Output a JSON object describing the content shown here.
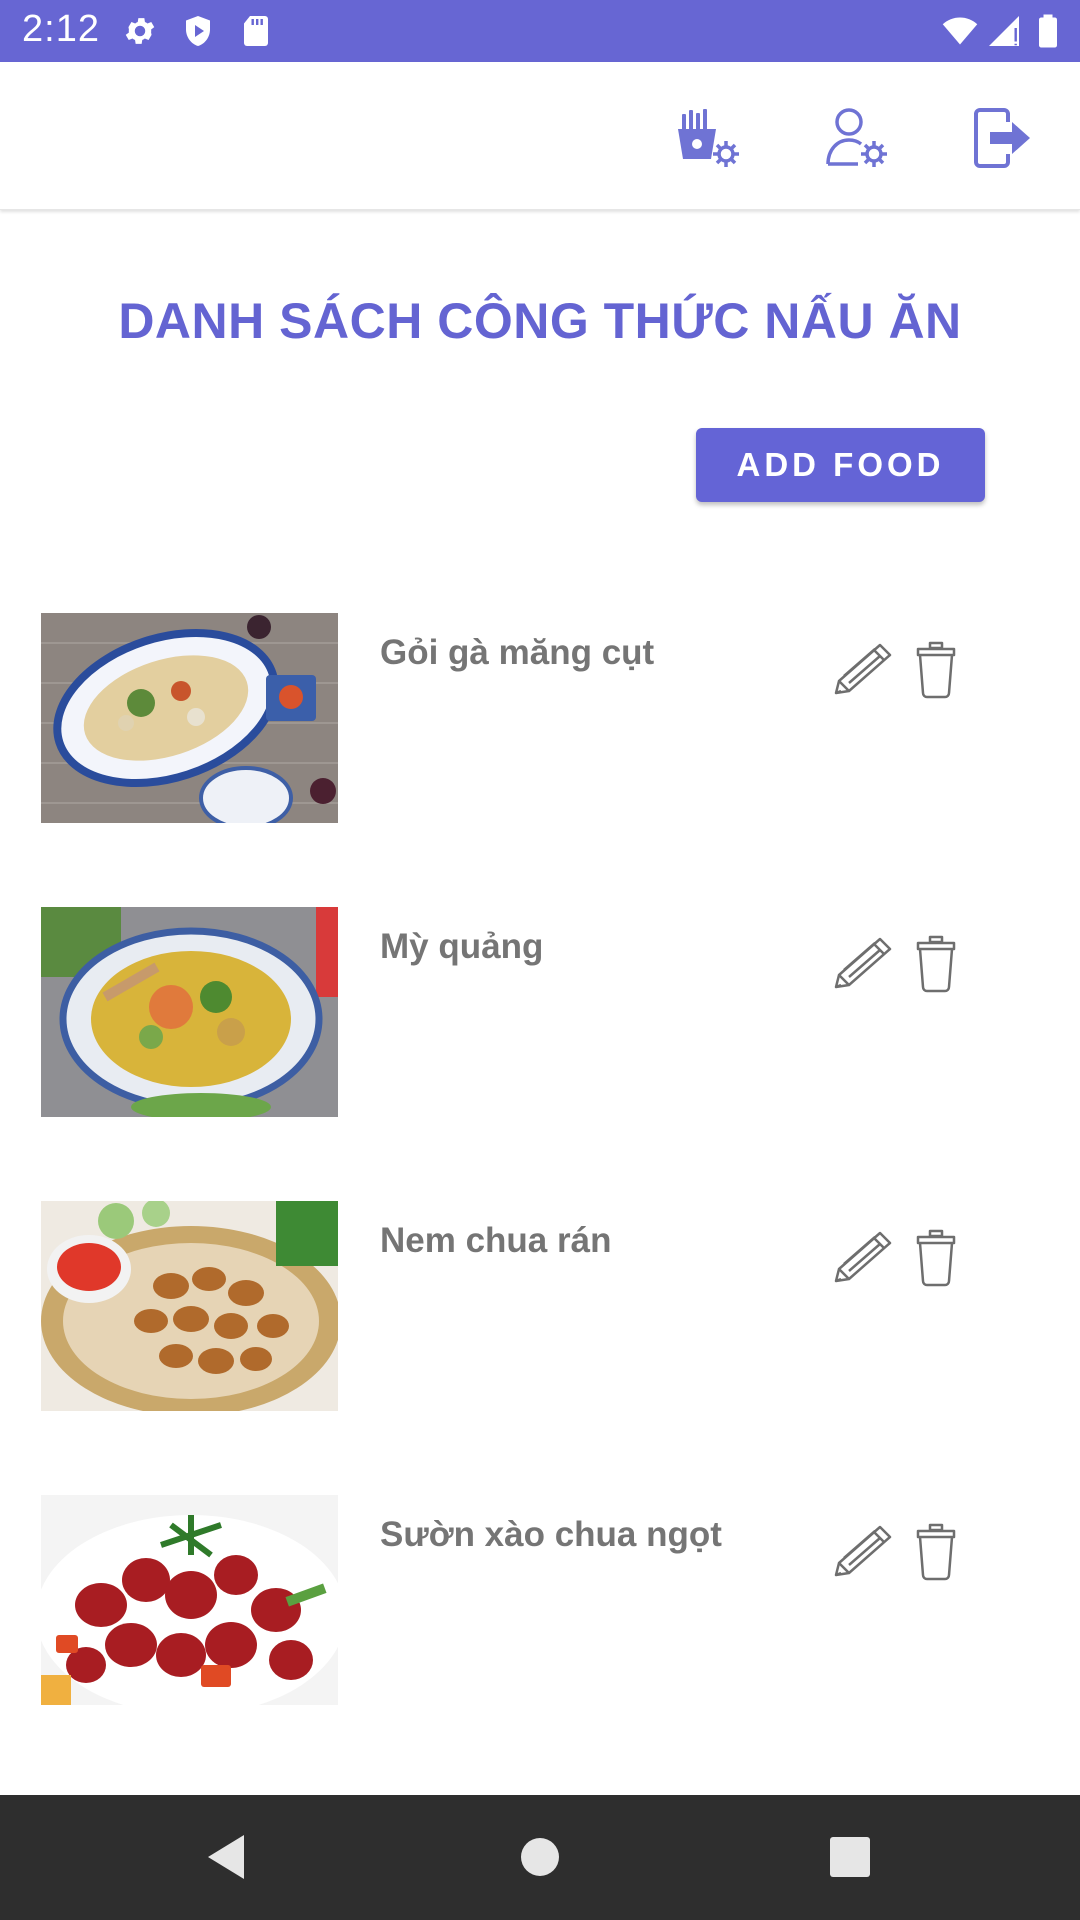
{
  "status_bar": {
    "time": "2:12",
    "left_icons": [
      "gear-icon",
      "play-protect-icon",
      "sd-card-icon"
    ],
    "right_icons": [
      "wifi-icon",
      "signal-icon",
      "battery-icon"
    ],
    "background": "#6766d3"
  },
  "app_bar": {
    "actions": [
      {
        "name": "manage-food-button",
        "icon": "food-settings-icon"
      },
      {
        "name": "user-settings-button",
        "icon": "user-settings-icon"
      },
      {
        "name": "logout-button",
        "icon": "logout-icon"
      }
    ]
  },
  "main": {
    "title": "DANH SÁCH CÔNG THỨC NẤU ĂN",
    "add_button_label": "ADD FOOD"
  },
  "foods": [
    {
      "name": "Gỏi gà măng cụt"
    },
    {
      "name": "Mỳ quảng"
    },
    {
      "name": "Nem chua rán"
    },
    {
      "name": "Sườn xào chua ngọt"
    }
  ],
  "nav_bar": {
    "buttons": [
      "back-icon",
      "home-icon",
      "recents-icon"
    ]
  },
  "colors": {
    "accent": "#6464d2",
    "icon_tint": "#6f73d4",
    "text_secondary": "#757575"
  }
}
